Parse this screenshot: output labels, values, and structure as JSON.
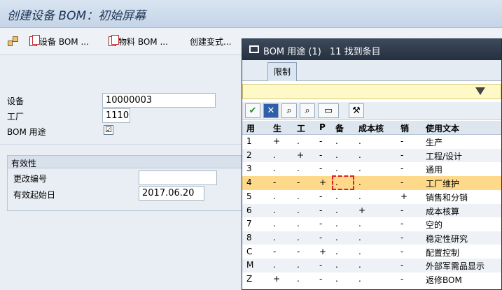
{
  "window_title": "创建设备 BOM：初始屏幕",
  "toolbar": {
    "btn1_label": "设备 BOM ...",
    "btn2_label": "物料 BOM ...",
    "btn3_label": "创建变式..."
  },
  "form": {
    "equipment_label": "设备",
    "equipment_value": "10000003",
    "plant_label": "工厂",
    "plant_value": "1110",
    "usage_label": "BOM 用途",
    "usage_check": "☑"
  },
  "validity": {
    "title": "有效性",
    "change_no_label": "更改编号",
    "change_no_value": "",
    "valid_from_label": "有效起始日",
    "valid_from_value": "2017.06.20"
  },
  "popup": {
    "title": "BOM 用途 (1)",
    "count_text": "11 找到条目",
    "tab_label": "限制",
    "columns": [
      "用",
      "生",
      "工",
      "P",
      "备",
      "成本核",
      "销",
      "使用文本"
    ],
    "rows": [
      [
        "1",
        "+",
        ".",
        "-",
        ".",
        ".",
        "-",
        "生产"
      ],
      [
        "2",
        ".",
        "+",
        "-",
        ".",
        ".",
        "-",
        "工程/设计"
      ],
      [
        "3",
        ".",
        ".",
        "-",
        ".",
        ".",
        "-",
        "通用"
      ],
      [
        "4",
        "-",
        "-",
        "+",
        ".",
        ".",
        "-",
        "工厂维护"
      ],
      [
        "5",
        ".",
        ".",
        "-",
        ".",
        ".",
        "+",
        "销售和分销"
      ],
      [
        "6",
        ".",
        ".",
        "-",
        ".",
        "+",
        "-",
        "成本核算"
      ],
      [
        "7",
        ".",
        ".",
        "-",
        ".",
        ".",
        "-",
        "空的"
      ],
      [
        "8",
        ".",
        ".",
        "-",
        ".",
        ".",
        "-",
        "稳定性研究"
      ],
      [
        "C",
        "-",
        "-",
        "+",
        ".",
        ".",
        "-",
        "配置控制"
      ],
      [
        "M",
        ".",
        ".",
        "-",
        ".",
        ".",
        "-",
        "外部军需品显示"
      ],
      [
        "Z",
        "+",
        ".",
        "-",
        ".",
        ".",
        "-",
        "返修BOM"
      ]
    ],
    "selected_row": 3
  },
  "colors": {
    "selected_row": "#ffd98a",
    "filter_bar": "#fff9c8",
    "popup_title_bg": "#2c3847"
  }
}
